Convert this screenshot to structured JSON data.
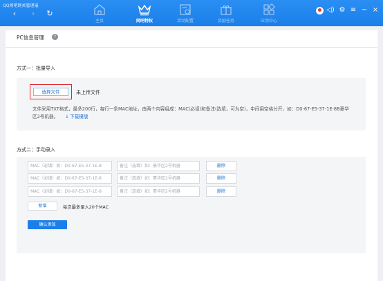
{
  "app": {
    "title": "QQ网吧网关管理端"
  },
  "nav": {
    "back": "‹",
    "forward": "›",
    "refresh": "↻"
  },
  "tabs": [
    {
      "label": "主页",
      "icon": "home-icon"
    },
    {
      "label": "网吧特权",
      "icon": "crown-icon",
      "active": true
    },
    {
      "label": "活动配置",
      "icon": "activity-config-icon"
    },
    {
      "label": "奖励任务",
      "icon": "gift-icon"
    },
    {
      "label": "应用中心",
      "icon": "app-grid-icon"
    }
  ],
  "system": {
    "speaker": "◁)",
    "settings": "⚙",
    "menu": "≡",
    "minimize": "−",
    "close": "×"
  },
  "page": {
    "title": "PC信息管理",
    "help": "?"
  },
  "method1": {
    "title": "方式一：批量导入",
    "choose_file": "选择文件",
    "no_file": "未上传文件",
    "description": "文件采用TXT格式，最多200行，每行一条MAC地址，由两个内容组成：MAC(必填)和备注(选填，可为空)，中间用空格分开，如：D0-67-E5-37-1E-8B豪华区2号机器。",
    "download_icon": "↓",
    "download_label": "下载模版"
  },
  "method2": {
    "title": "方式二：手动录入",
    "mac_placeholder": "MAC（必填）如：D0-67-E5-37-1E-8",
    "note_placeholder": "备注（选填）如：豪华区2号机器",
    "delete_label": "删除",
    "add_label": "新增",
    "max_tip": "每次最多录入20个MAC",
    "confirm_label": "确认添加"
  },
  "colors": {
    "topbar": "#1a7fe8",
    "accent": "#1b73d6",
    "highlight_border": "#e0262d"
  }
}
